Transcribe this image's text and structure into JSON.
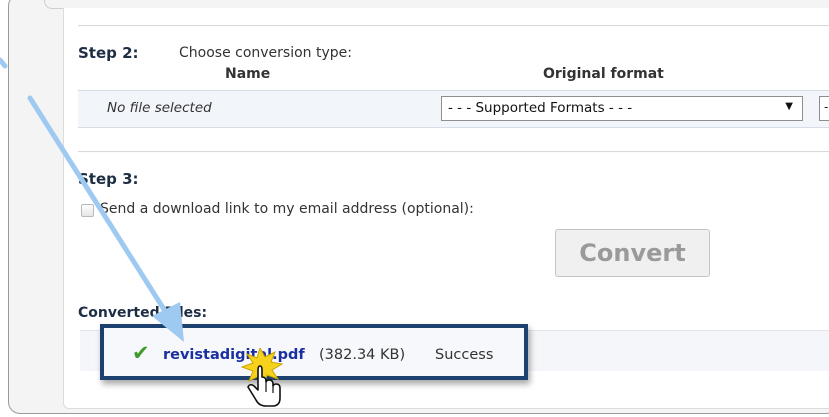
{
  "step2": {
    "label": "Step 2:",
    "description": "Choose conversion type:",
    "col_name": "Name",
    "col_original_format": "Original format",
    "file_name_value": "No file selected",
    "format_select_value": "- - - Supported Formats - - -",
    "format_select_arrow": "▼",
    "second_select_value": "-"
  },
  "step3": {
    "label": "Step 3:",
    "email_option_label": "Send a download link to my email address (optional):"
  },
  "convert_button_label": "Convert",
  "converted_files": {
    "heading": "Converted Files:",
    "items": [
      {
        "file_name": "revistadigital.pdf",
        "size": "(382.34 KB)",
        "status": "Success"
      }
    ]
  },
  "icons": {
    "success": "check-icon",
    "pointer": "hand-cursor-icon",
    "annotation": "arrow-annotation"
  },
  "colors": {
    "step_label": "#1d2d44",
    "link": "#1a2fa0",
    "highlight_border": "#1c416e",
    "check": "#3f9b2d",
    "arrow": "#9ec9f0",
    "button_text": "#9a9a9a"
  }
}
